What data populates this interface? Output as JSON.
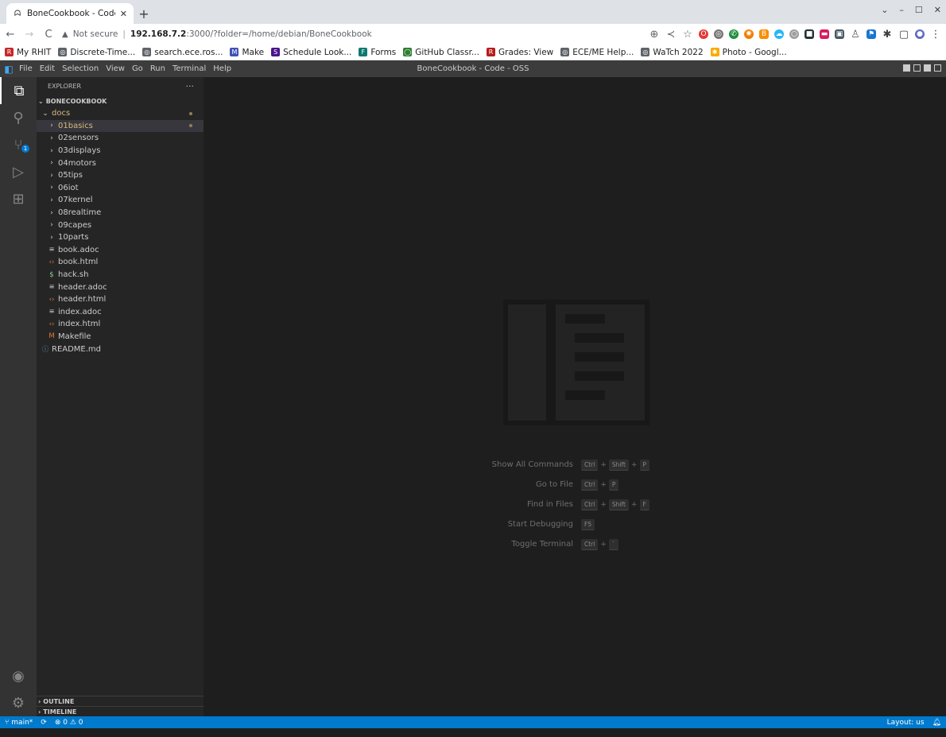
{
  "browser": {
    "tab_title": "BoneCookbook - Code - O",
    "tab_favicon": "beaglebone-icon",
    "address": {
      "security": "Not secure",
      "host": "192.168.7.2",
      "path": ":3000/?folder=/home/debian/BoneCookbook"
    },
    "bookmarks": [
      {
        "label": "My RHIT",
        "icon": "R",
        "color": "#c62828"
      },
      {
        "label": "Discrete-Time...",
        "icon": "◎",
        "color": "#5f6368"
      },
      {
        "label": "search.ece.ros...",
        "icon": "◎",
        "color": "#5f6368"
      },
      {
        "label": "Make",
        "icon": "M",
        "color": "#3f51b5"
      },
      {
        "label": "Schedule Look...",
        "icon": "S",
        "color": "#4a148c"
      },
      {
        "label": "Forms",
        "icon": "F",
        "color": "#0b7a6f"
      },
      {
        "label": "GitHub Classr...",
        "icon": "◯",
        "color": "#2e7d32"
      },
      {
        "label": "Grades: View",
        "icon": "R",
        "color": "#b71c1c"
      },
      {
        "label": "ECE/ME Help...",
        "icon": "◎",
        "color": "#5f6368"
      },
      {
        "label": "WaTch 2022",
        "icon": "◎",
        "color": "#5f6368"
      },
      {
        "label": "Photo - Googl...",
        "icon": "✱",
        "color": "#f9ab00"
      }
    ]
  },
  "vscode": {
    "menu": [
      "File",
      "Edit",
      "Selection",
      "View",
      "Go",
      "Run",
      "Terminal",
      "Help"
    ],
    "window_title": "BoneCookbook - Code - OSS",
    "explorer": {
      "header": "EXPLORER",
      "root": "BONECOOKBOOK",
      "items": [
        {
          "label": "docs",
          "kind": "folder-open",
          "depth": 1,
          "modified": true
        },
        {
          "label": "01basics",
          "kind": "folder",
          "depth": 2,
          "modified": true,
          "selected": true
        },
        {
          "label": "02sensors",
          "kind": "folder",
          "depth": 2
        },
        {
          "label": "03displays",
          "kind": "folder",
          "depth": 2
        },
        {
          "label": "04motors",
          "kind": "folder",
          "depth": 2
        },
        {
          "label": "05tips",
          "kind": "folder",
          "depth": 2
        },
        {
          "label": "06iot",
          "kind": "folder",
          "depth": 2
        },
        {
          "label": "07kernel",
          "kind": "folder",
          "depth": 2
        },
        {
          "label": "08realtime",
          "kind": "folder",
          "depth": 2
        },
        {
          "label": "09capes",
          "kind": "folder",
          "depth": 2
        },
        {
          "label": "10parts",
          "kind": "folder",
          "depth": 2
        },
        {
          "label": "book.adoc",
          "kind": "adoc",
          "depth": 2
        },
        {
          "label": "book.html",
          "kind": "html",
          "depth": 2
        },
        {
          "label": "hack.sh",
          "kind": "sh",
          "depth": 2
        },
        {
          "label": "header.adoc",
          "kind": "adoc",
          "depth": 2
        },
        {
          "label": "header.html",
          "kind": "html",
          "depth": 2
        },
        {
          "label": "index.adoc",
          "kind": "adoc",
          "depth": 2
        },
        {
          "label": "index.html",
          "kind": "html",
          "depth": 2
        },
        {
          "label": "Makefile",
          "kind": "make",
          "depth": 2
        },
        {
          "label": "README.md",
          "kind": "md",
          "depth": 1
        }
      ],
      "outline": "OUTLINE",
      "timeline": "TIMELINE"
    },
    "scm_badge": "1",
    "shortcuts": [
      {
        "label": "Show All Commands",
        "keys": [
          "Ctrl",
          "Shift",
          "P"
        ]
      },
      {
        "label": "Go to File",
        "keys": [
          "Ctrl",
          "P"
        ]
      },
      {
        "label": "Find in Files",
        "keys": [
          "Ctrl",
          "Shift",
          "F"
        ]
      },
      {
        "label": "Start Debugging",
        "keys": [
          "F5"
        ]
      },
      {
        "label": "Toggle Terminal",
        "keys": [
          "Ctrl",
          "`"
        ]
      }
    ],
    "status": {
      "branch": "main*",
      "problems": "⊗ 0 ⚠ 0",
      "layout": "Layout: us"
    }
  }
}
